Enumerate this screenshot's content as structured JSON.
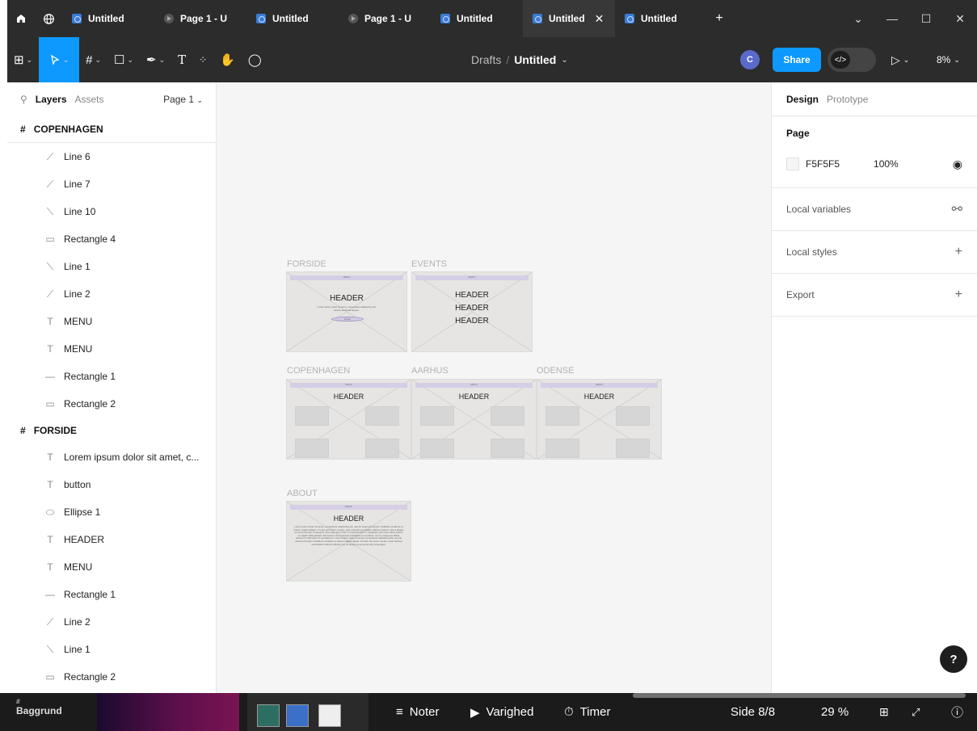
{
  "tabs": [
    {
      "label": "Untitled",
      "kind": "file"
    },
    {
      "label": "Page 1 - U",
      "kind": "proto"
    },
    {
      "label": "Untitled",
      "kind": "file"
    },
    {
      "label": "Page 1 - U",
      "kind": "proto"
    },
    {
      "label": "Untitled",
      "kind": "file"
    },
    {
      "label": "Untitled",
      "kind": "file",
      "active": true
    },
    {
      "label": "Untitled",
      "kind": "file"
    }
  ],
  "breadcrumb": {
    "drafts": "Drafts",
    "sep": "/",
    "file": "Untitled"
  },
  "toolbar": {
    "avatar": "C",
    "share": "Share",
    "dev": "</>",
    "zoom": "8%"
  },
  "left": {
    "tab_layers": "Layers",
    "tab_assets": "Assets",
    "page": "Page 1",
    "frame1": "COPENHAGEN",
    "frame1_items": [
      {
        "icon": "line-icon",
        "glyph": "⟋",
        "label": "Line 6"
      },
      {
        "icon": "line-icon",
        "glyph": "⟋",
        "label": "Line 7"
      },
      {
        "icon": "line-icon",
        "glyph": "⟍",
        "label": "Line 10"
      },
      {
        "icon": "rectangle-icon",
        "glyph": "▭",
        "label": "Rectangle 4"
      },
      {
        "icon": "line-icon",
        "glyph": "⟍",
        "label": "Line 1"
      },
      {
        "icon": "line-icon",
        "glyph": "⟋",
        "label": "Line 2"
      },
      {
        "icon": "text-icon",
        "glyph": "T",
        "label": "MENU"
      },
      {
        "icon": "text-icon",
        "glyph": "T",
        "label": "MENU"
      },
      {
        "icon": "rectangle-icon",
        "glyph": "—",
        "label": "Rectangle 1"
      },
      {
        "icon": "rectangle-icon",
        "glyph": "▭",
        "label": "Rectangle 2"
      }
    ],
    "frame2": "FORSIDE",
    "frame2_items": [
      {
        "icon": "text-icon",
        "glyph": "T",
        "label": "Lorem ipsum dolor sit amet, c..."
      },
      {
        "icon": "text-icon",
        "glyph": "T",
        "label": "button"
      },
      {
        "icon": "ellipse-icon",
        "glyph": "⬭",
        "label": "Ellipse 1"
      },
      {
        "icon": "text-icon",
        "glyph": "T",
        "label": "HEADER"
      },
      {
        "icon": "text-icon",
        "glyph": "T",
        "label": "MENU"
      },
      {
        "icon": "rectangle-icon",
        "glyph": "—",
        "label": "Rectangle 1"
      },
      {
        "icon": "line-icon",
        "glyph": "⟋",
        "label": "Line 2"
      },
      {
        "icon": "line-icon",
        "glyph": "⟍",
        "label": "Line 1"
      },
      {
        "icon": "rectangle-icon",
        "glyph": "▭",
        "label": "Rectangle 2"
      }
    ]
  },
  "canvas": {
    "labels": {
      "forside": "FORSIDE",
      "events": "EVENTS",
      "copenhagen": "COPENHAGEN",
      "aarhus": "AARHUS",
      "odense": "ODENSE",
      "about": "ABOUT"
    },
    "menu": "MENU",
    "header": "HEADER",
    "lorem": "Lorem ipsum dolor sit amet, consectetur adipiscing elit, sed do eiusmod tempor incididunt ut labore et dolore magna aliqua. Ut enim ad minim veniam, quis nostrud exercitation ullamco laboris nisi ut aliquip ex ea commodo consequat. Duis aute irure dolor in reprehenderit in voluptate velit esse cillum dolore eu fugiat nulla pariatur. Excepteur sint occaecat cupidatat non proident, sunt in culpa qui officia deserunt mollit anim id est laborum. Lorem ipsum dolor sit amet, consectetur adipiscing elit, sed do eiusmod tempor incididunt ut labore et dolore magna aliqua. Ut enim ad minim veniam, quis nostrud exercitation ullamco laboris nisi ut aliquip ex ea commodo consequat.",
    "forside_text": "Lorem ipsum dolor sit amet, consectetur adipiscing elit, sed do eiusmod tempor.",
    "button": "button"
  },
  "right": {
    "tab_design": "Design",
    "tab_prototype": "Prototype",
    "page_title": "Page",
    "page_color": "F5F5F5",
    "page_opacity": "100%",
    "local_variables": "Local variables",
    "local_styles": "Local styles",
    "export": "Export",
    "help": "?"
  },
  "taskbar": {
    "background": "Baggrund",
    "notes": "Noter",
    "duration": "Varighed",
    "timer": "Timer",
    "slide": "Side 8/8",
    "zoom": "29 %"
  }
}
